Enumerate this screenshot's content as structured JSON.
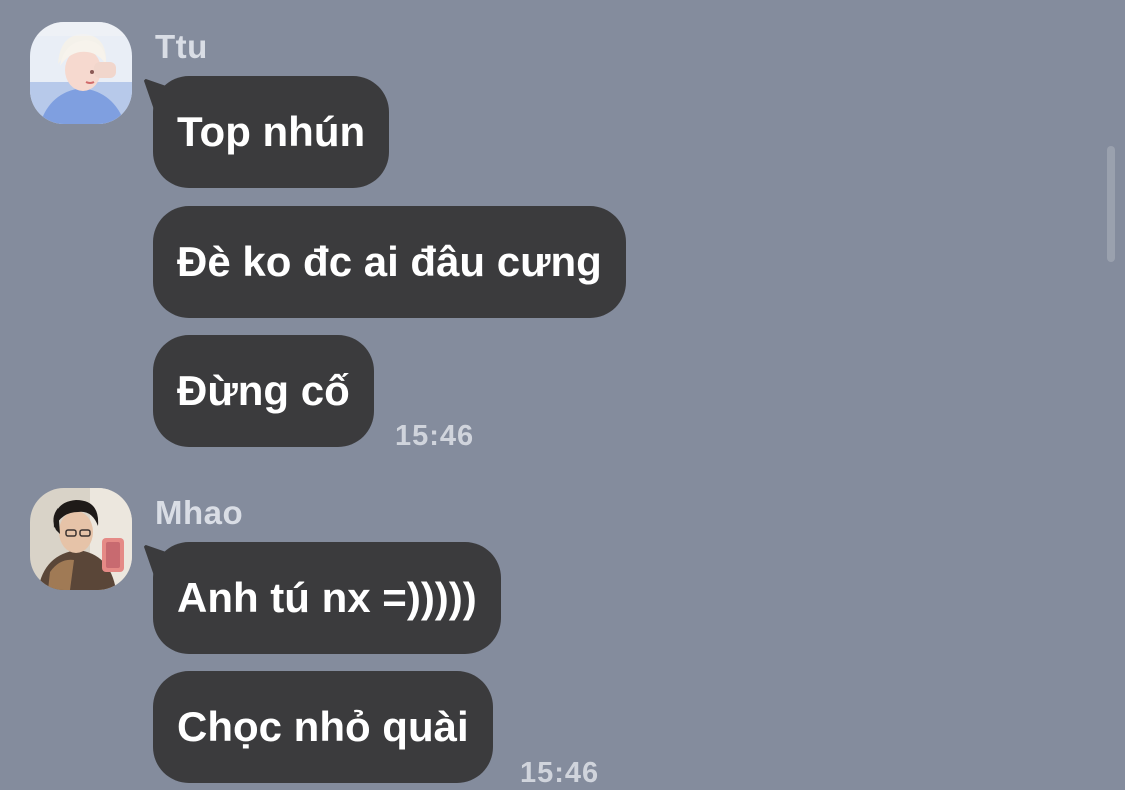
{
  "colors": {
    "background": "#848c9d",
    "bubble": "#3b3b3d",
    "bubble_text": "#ffffff",
    "sender_name": "#d9dde5",
    "timestamp": "#d0d4dc"
  },
  "messages": [
    {
      "sender": "Ttu",
      "avatar_icon": "user-avatar-blonde",
      "bubbles": [
        "Top nhún",
        "Đè ko đc ai đâu cưng",
        "Đừng cố"
      ],
      "time": "15:46"
    },
    {
      "sender": "Mhao",
      "avatar_icon": "user-avatar-dark-hair",
      "bubbles": [
        "Anh tú nx =)))))",
        "Chọc nhỏ quài"
      ],
      "time": "15:46"
    }
  ]
}
